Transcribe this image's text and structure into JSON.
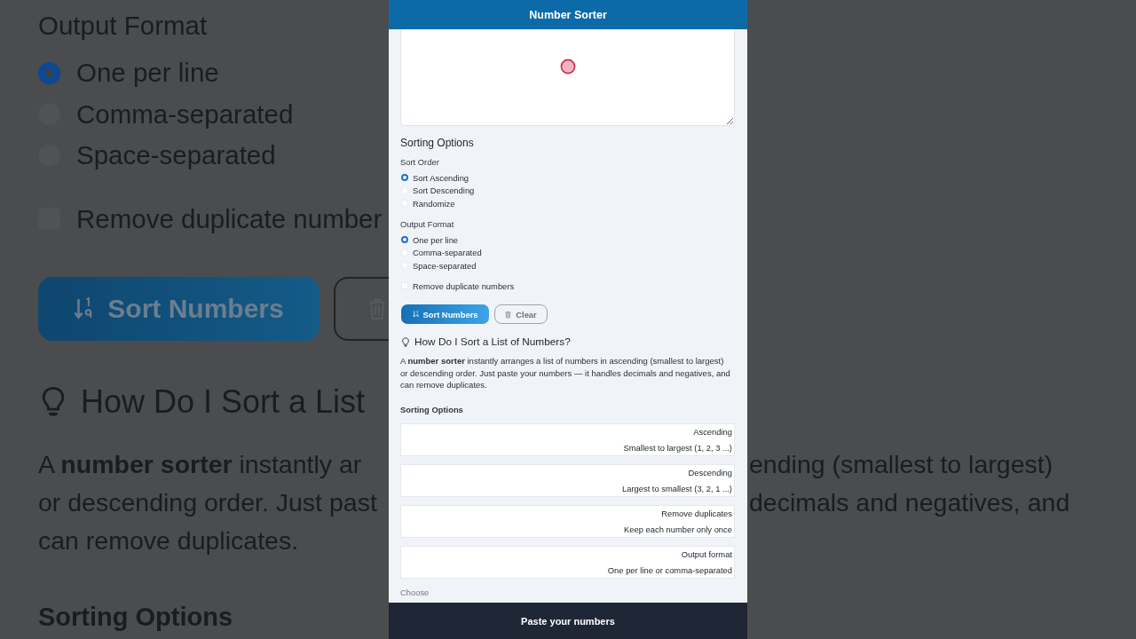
{
  "backdrop": {
    "left": {
      "section_label": "Output Format",
      "options": [
        {
          "label": "One per line",
          "selected": true
        },
        {
          "label": "Comma-separated",
          "selected": false
        },
        {
          "label": "Space-separated",
          "selected": false
        }
      ],
      "checkbox": {
        "label": "Remove duplicate number",
        "checked": false
      },
      "buttons": [
        {
          "kind": "primary",
          "label": "Sort Numbers"
        },
        {
          "kind": "secondary"
        }
      ],
      "heading": "How Do I Sort a List",
      "paragraph_lines": [
        "A **number sorter** instantly ar",
        "or descending order. Just past",
        "can remove duplicates."
      ],
      "subheading": "Sorting Options"
    },
    "right": {
      "paragraph_lines": [
        "ending (smallest to largest)",
        "decimals and negatives, and"
      ]
    }
  },
  "app": {
    "title": "Number Sorter",
    "settings_heading": "Sorting Options",
    "sort_order": {
      "label": "Sort Order",
      "options": [
        {
          "label": "Sort Ascending",
          "selected": true
        },
        {
          "label": "Sort Descending",
          "selected": false
        },
        {
          "label": "Randomize",
          "selected": false
        }
      ]
    },
    "output_format": {
      "label": "Output Format",
      "options": [
        {
          "label": "One per line",
          "selected": true
        },
        {
          "label": "Comma-separated",
          "selected": false
        },
        {
          "label": "Space-separated",
          "selected": false
        }
      ]
    },
    "remove_duplicates": {
      "label": "Remove duplicate numbers",
      "checked": false
    },
    "buttons": [
      {
        "kind": "primary",
        "label": "Sort Numbers"
      },
      {
        "kind": "secondary",
        "label": "Clear"
      }
    ],
    "faq": {
      "heading": "How Do I Sort a List of Numbers?",
      "paragraph": "A **number sorter** instantly arranges a list of numbers in ascending (smallest to largest) or descending order. Just paste your numbers — it handles decimals and negatives, and can remove duplicates.",
      "subheading": "Sorting Options",
      "cards": [
        {
          "title": "Ascending",
          "description": "Smallest to largest (1, 2, 3 ...)"
        },
        {
          "title": "Descending",
          "description": "Largest to smallest (3, 2, 1 ...)"
        },
        {
          "title": "Remove duplicates",
          "description": "Keep each number only once"
        },
        {
          "title": "Output format",
          "description": "One per line or comma-separated"
        }
      ],
      "trailing_text": "Choose"
    },
    "bottom_bar": {
      "label": "Paste your numbers"
    }
  }
}
